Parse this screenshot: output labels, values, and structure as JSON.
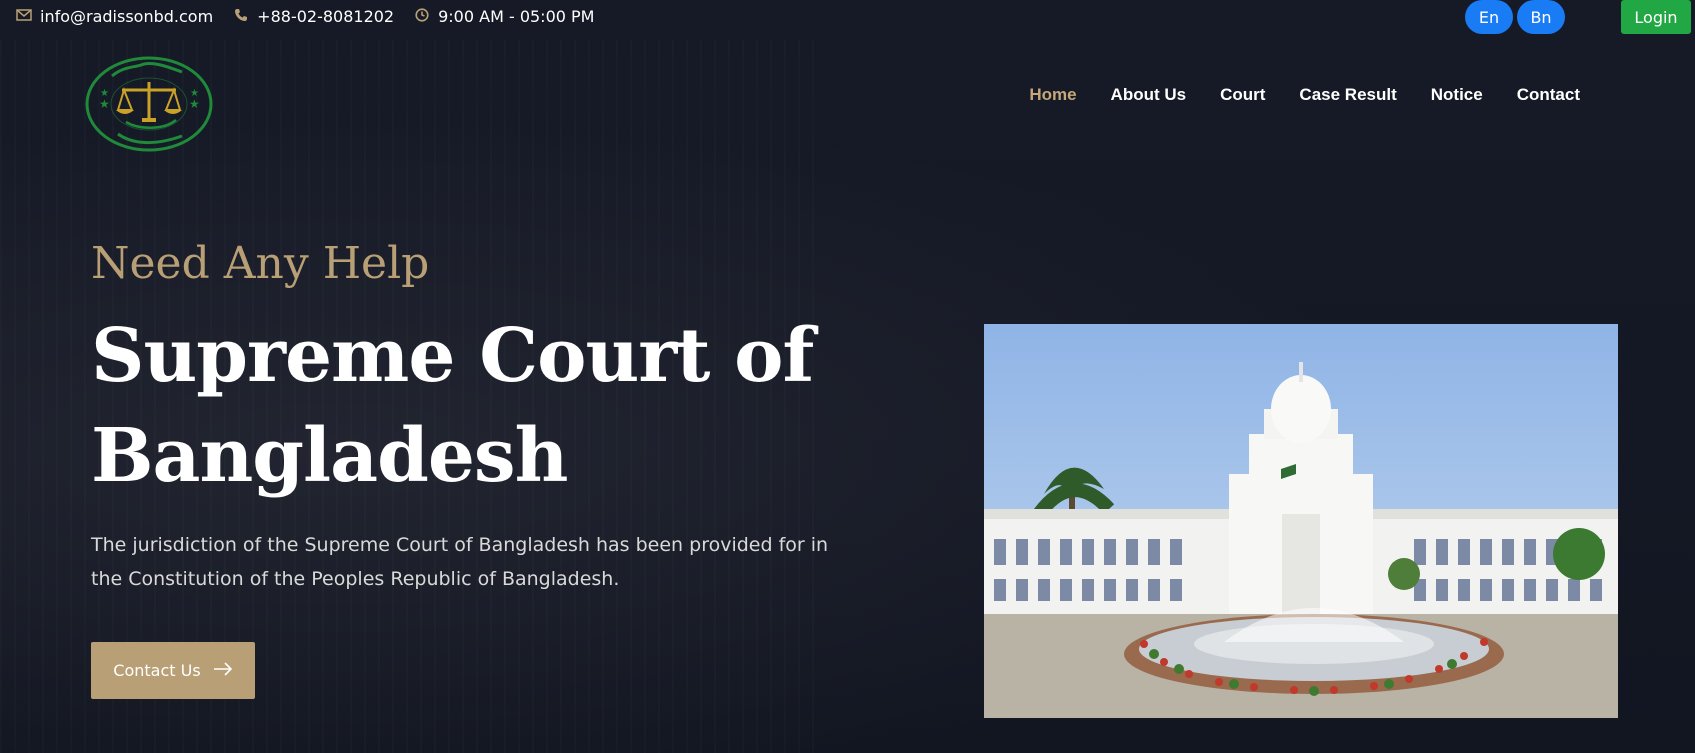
{
  "topbar": {
    "email": "info@radissonbd.com",
    "phone": "+88-02-8081202",
    "hours": "9:00 AM - 05:00 PM",
    "lang_en": "En",
    "lang_bn": "Bn",
    "login": "Login"
  },
  "nav": {
    "items": [
      {
        "label": "Home",
        "active": true
      },
      {
        "label": "About Us"
      },
      {
        "label": "Court"
      },
      {
        "label": "Case Result"
      },
      {
        "label": "Notice"
      },
      {
        "label": "Contact"
      }
    ]
  },
  "hero": {
    "eyebrow": "Need Any Help",
    "title_line1": "Supreme Court of",
    "title_line2": "Bangladesh",
    "description": "The jurisdiction of the Supreme Court of Bangladesh has been provided for in the Constitution of the Peoples Republic of Bangladesh.",
    "cta": "Contact Us"
  },
  "colors": {
    "accent": "#b89f75",
    "background": "#141824",
    "lang_button": "#1a7cf5",
    "login_button": "#22a745"
  },
  "icons": {
    "email": "envelope-icon",
    "phone": "phone-icon",
    "hours": "clock-icon",
    "cta": "arrow-right-icon"
  }
}
